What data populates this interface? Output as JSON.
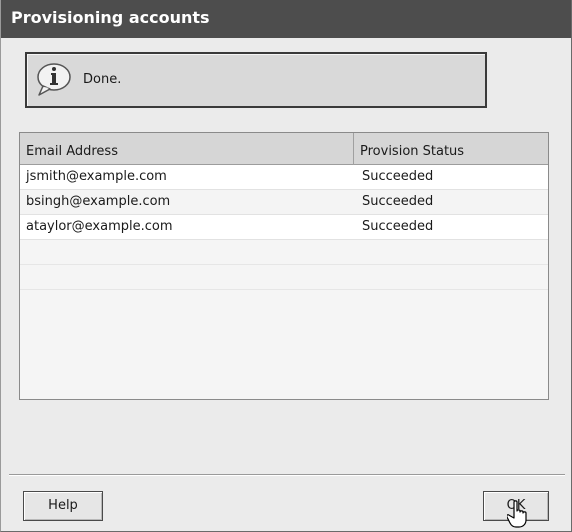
{
  "window": {
    "title": "Provisioning accounts"
  },
  "message": {
    "icon": "info-speech-icon",
    "text": "Done."
  },
  "table": {
    "headers": [
      "Email Address",
      "Provision Status"
    ],
    "rows": [
      {
        "email": "jsmith@example.com",
        "status": "Succeeded"
      },
      {
        "email": "bsingh@example.com",
        "status": "Succeeded"
      },
      {
        "email": "ataylor@example.com",
        "status": "Succeeded"
      }
    ]
  },
  "buttons": {
    "help": "Help",
    "ok": "OK"
  },
  "colors": {
    "titlebar": "#4d4d4d",
    "dialog_bg": "#ebebeb",
    "header_bg": "#d6d6d6"
  }
}
